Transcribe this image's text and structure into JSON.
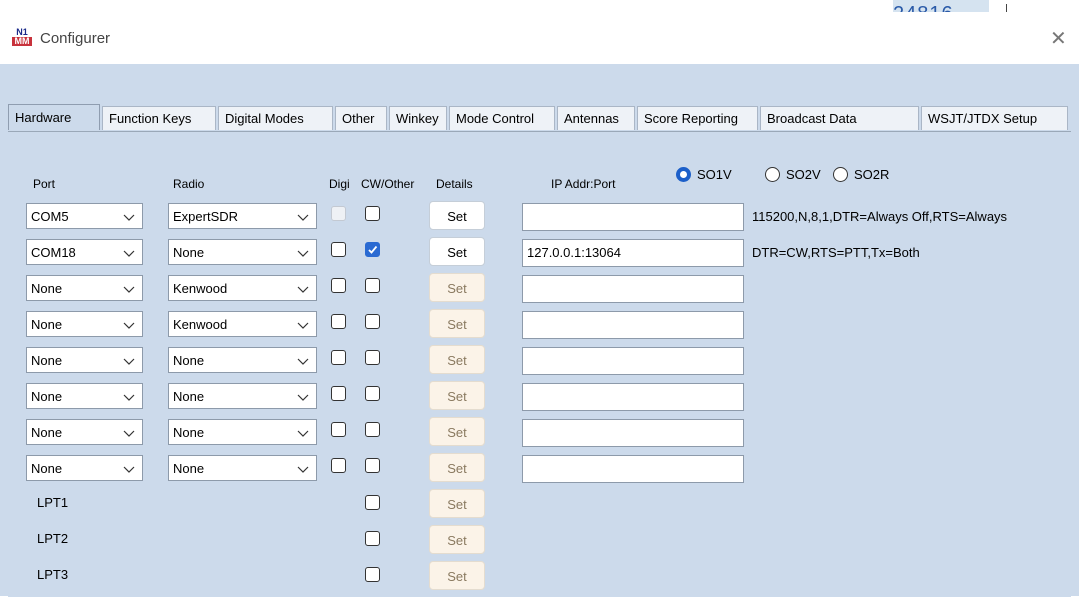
{
  "background": {
    "number": "24816"
  },
  "window": {
    "title": "Configurer",
    "logo_text": "N1MM"
  },
  "tabs": [
    {
      "label": "Hardware",
      "active": true
    },
    {
      "label": "Function Keys"
    },
    {
      "label": "Digital Modes"
    },
    {
      "label": "Other"
    },
    {
      "label": "Winkey"
    },
    {
      "label": "Mode Control"
    },
    {
      "label": "Antennas"
    },
    {
      "label": "Score Reporting"
    },
    {
      "label": "Broadcast Data"
    },
    {
      "label": "WSJT/JTDX Setup"
    }
  ],
  "so_mode": {
    "options": [
      "SO1V",
      "SO2V",
      "SO2R"
    ],
    "selected": "SO1V"
  },
  "headers": {
    "port": "Port",
    "radio": "Radio",
    "digi": "Digi",
    "cw_other": "CW/Other",
    "details": "Details",
    "ip": "IP Addr:Port"
  },
  "rows": [
    {
      "port": "COM5",
      "radio": "ExpertSDR",
      "digi": false,
      "digi_disabled": true,
      "cw": false,
      "set": "Set",
      "set_enabled": true,
      "ip": "",
      "info": "115200,N,8,1,DTR=Always Off,RTS=Always"
    },
    {
      "port": "COM18",
      "radio": "None",
      "digi": false,
      "cw": true,
      "set": "Set",
      "set_enabled": true,
      "ip": "127.0.0.1:13064",
      "info": "DTR=CW,RTS=PTT,Tx=Both"
    },
    {
      "port": "None",
      "radio": "Kenwood",
      "digi": false,
      "cw": false,
      "set": "Set",
      "ip": ""
    },
    {
      "port": "None",
      "radio": "Kenwood",
      "digi": false,
      "cw": false,
      "set": "Set",
      "ip": ""
    },
    {
      "port": "None",
      "radio": "None",
      "digi": false,
      "cw": false,
      "set": "Set",
      "ip": ""
    },
    {
      "port": "None",
      "radio": "None",
      "digi": false,
      "cw": false,
      "set": "Set",
      "ip": ""
    },
    {
      "port": "None",
      "radio": "None",
      "digi": false,
      "cw": false,
      "set": "Set",
      "ip": ""
    },
    {
      "port": "None",
      "radio": "None",
      "digi": false,
      "cw": false,
      "set": "Set",
      "ip": ""
    }
  ],
  "lpt_rows": [
    {
      "label": "LPT1",
      "cw": false,
      "set": "Set"
    },
    {
      "label": "LPT2",
      "cw": false,
      "set": "Set"
    },
    {
      "label": "LPT3",
      "cw": false,
      "set": "Set"
    }
  ],
  "icons": {
    "dropdown": "chevron-down-icon",
    "close": "close-icon",
    "check": "checkmark-icon",
    "logo": "n1mm-logo-icon"
  },
  "colors": {
    "panel": "#ccdaeb",
    "checked": "#2a6ad2",
    "radio_selected": "#1c5fc9",
    "set_disabled_bg": "#fbf3e8"
  }
}
